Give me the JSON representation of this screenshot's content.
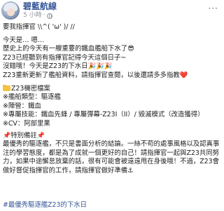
{
  "header": {
    "page_name": "碧藍航線",
    "time": "5 小時",
    "separator": "·",
    "more": "···"
  },
  "post": {
    "lines": [
      "要我指揮官 \\\\^( 'ω' )/ //",
      "",
      "今天是… 嗯…",
      "歷史上的今天有一艘重要的鐵血艦船下水了😎",
      "Z23已經聽到有指揮官記得今天這個日子~",
      "沒錯哦！今天是Z23的下水日🎉🎉🎉",
      "Z23重新更新了艦船資料，請指揮官查閱，以後還請多多指教❤️"
    ],
    "profile_title": "Z23機密檔案",
    "profile_items": [
      "※艦船類型：驅逐艦",
      "※陣營：鐵血",
      "※專屬技能：鐵血先鋒 / 專屬彈幕-Z23I（II）/ 毀滅模式（改造獲得）",
      "※CV：阿部里果"
    ],
    "notice_title": "特別備註",
    "notice_text": "最優秀的驅逐艦，不只是書面分析的結論。一絲不苟的處事風格以及認真事注的學習態度，都是為了成就一個更好的自己！請指揮官一起與Z23共同努力，如果中途懈怠放棄的話，很有可能會被遠遠甩在身後哦！不過，Z23會做好督促指揮官的工作，請指揮官做好準備⚓"
  },
  "hashtag": "#最優秀驅逐艦Z23的下水日"
}
